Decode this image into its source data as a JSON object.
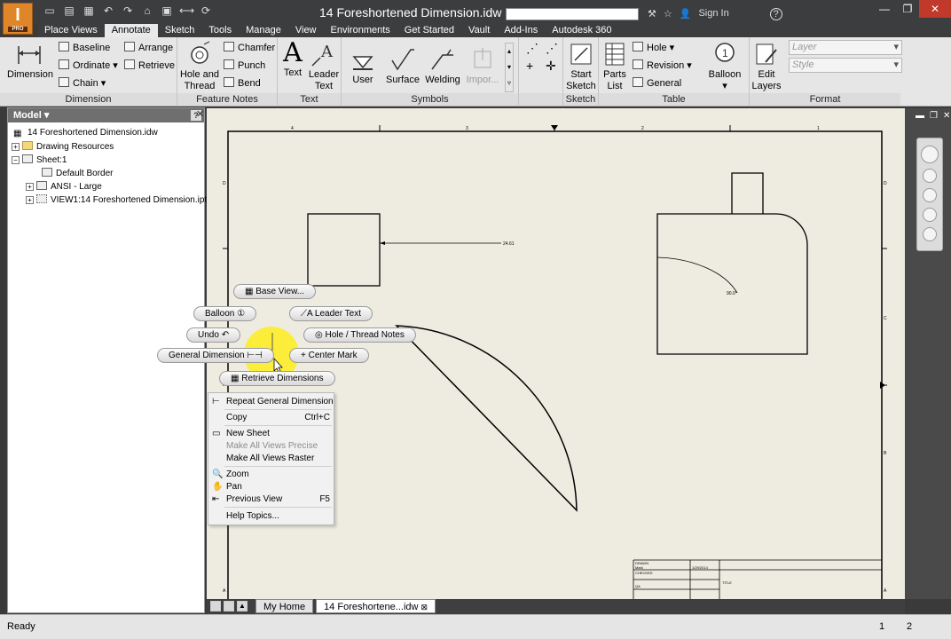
{
  "app": {
    "logo_text": "I",
    "logo_sub": "PRO",
    "window_title": "14 Foreshortened Dimension.idw",
    "sign_in": "Sign In",
    "help": "?"
  },
  "tabs": [
    "Place Views",
    "Annotate",
    "Sketch",
    "Tools",
    "Manage",
    "View",
    "Environments",
    "Get Started",
    "Vault",
    "Add-Ins",
    "Autodesk 360"
  ],
  "ribbon": {
    "dimension_group": {
      "label": "Dimension",
      "dimension_btn": "Dimension",
      "baseline": "Baseline",
      "ordinate": "Ordinate",
      "chain": "Chain",
      "arrange": "Arrange",
      "retrieve": "Retrieve"
    },
    "feature_notes_group": {
      "label": "Feature Notes",
      "hole_and_thread": "Hole and Thread",
      "chamfer": "Chamfer",
      "punch": "Punch",
      "bend": "Bend"
    },
    "text_group": {
      "label": "Text",
      "text_btn": "Text",
      "leader_text": "Leader Text"
    },
    "symbols_group": {
      "label": "Symbols",
      "user": "User",
      "surface": "Surface",
      "welding": "Welding",
      "import": "Impor..."
    },
    "sketch_group": {
      "label": "Sketch",
      "start_sketch": "Start Sketch"
    },
    "table_group": {
      "label": "Table",
      "parts_list": "Parts List",
      "hole": "Hole",
      "revision": "Revision",
      "general": "General",
      "balloon": "Balloon"
    },
    "format_group": {
      "label": "Format",
      "edit_layers": "Edit Layers",
      "layer_placeholder": "Layer",
      "style_placeholder": "Style"
    }
  },
  "browser": {
    "title": "Model",
    "items": [
      "14 Foreshortened Dimension.idw",
      "Drawing Resources",
      "Sheet:1",
      "Default Border",
      "ANSI - Large",
      "VIEW1:14 Foreshortened Dimension.ipt"
    ]
  },
  "drawing": {
    "dim_linear": "24.61",
    "dim_radial": "90.0°",
    "title_block": {
      "drawn": "DRAWN",
      "name": "Mark",
      "date": "1/29/2014",
      "checked": "CHECKED",
      "qa": "QA",
      "title": "TITLE"
    },
    "zone_numbers": [
      "4",
      "3",
      "2",
      "1"
    ],
    "zone_letters": [
      "D",
      "C",
      "B",
      "A"
    ]
  },
  "marking_menu": {
    "base_view": "Base View...",
    "balloon": "Balloon",
    "leader_text": "Leader Text",
    "undo": "Undo",
    "hole_thread_notes": "Hole / Thread Notes",
    "general_dimension": "General Dimension",
    "center_mark": "Center Mark",
    "retrieve_dimensions": "Retrieve Dimensions"
  },
  "context_menu": {
    "repeat": "Repeat General Dimension",
    "copy": "Copy",
    "copy_shortcut": "Ctrl+C",
    "new_sheet": "New Sheet",
    "make_precise": "Make All Views Precise",
    "make_raster": "Make All Views Raster",
    "zoom": "Zoom",
    "pan": "Pan",
    "previous_view": "Previous View",
    "previous_shortcut": "F5",
    "help_topics": "Help Topics..."
  },
  "doc_tabs": [
    "My Home",
    "14 Foreshortene...idw"
  ],
  "status": {
    "text": "Ready",
    "pages": [
      "1",
      "2"
    ]
  },
  "colors": {
    "accent": "#e08628",
    "sheet_bg": "#eeece1",
    "highlight": "#ffee00"
  }
}
